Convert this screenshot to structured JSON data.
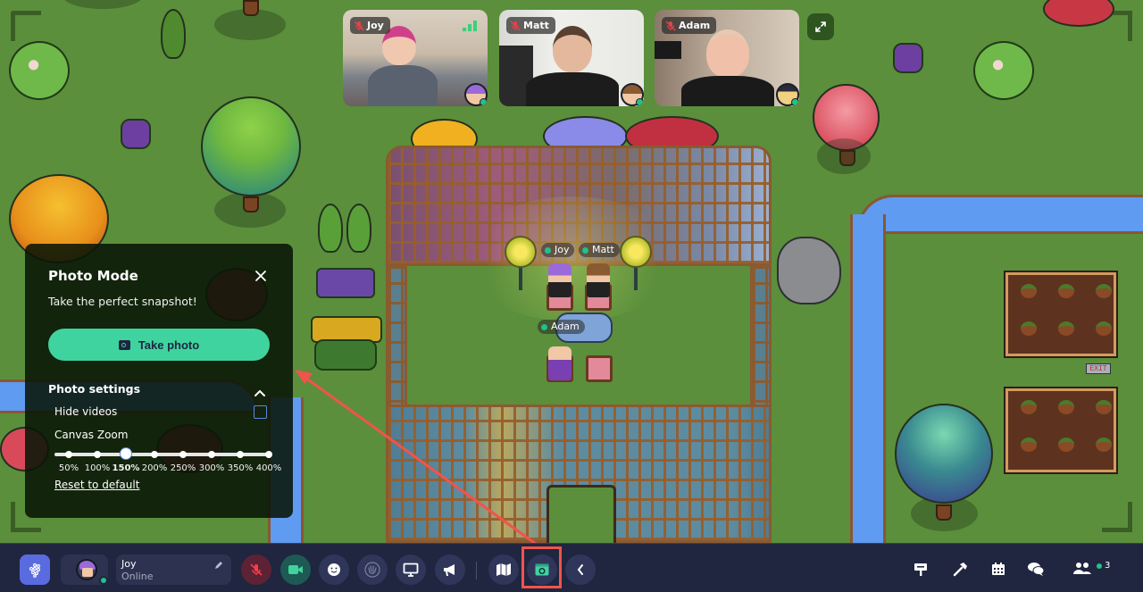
{
  "map": {
    "players": [
      {
        "name": "Joy",
        "status_color": "#1fc28b"
      },
      {
        "name": "Matt",
        "status_color": "#1fc28b"
      },
      {
        "name": "Adam",
        "status_color": "#1fc28b"
      }
    ],
    "signs": {
      "exit": "EXIT"
    }
  },
  "videos": [
    {
      "name": "Joy",
      "muted": true,
      "icon": "mic-off-icon",
      "show_signal": true
    },
    {
      "name": "Matt",
      "muted": true,
      "icon": "mic-off-icon",
      "show_signal": false
    },
    {
      "name": "Adam",
      "muted": true,
      "icon": "mic-off-icon",
      "show_signal": false
    }
  ],
  "video_controls": {
    "expand_icon": "expand-icon"
  },
  "photo_mode": {
    "title": "Photo Mode",
    "subtitle": "Take the perfect snapshot!",
    "take_photo_label": "Take photo",
    "settings_title": "Photo settings",
    "settings_expanded": true,
    "hide_videos_label": "Hide videos",
    "hide_videos_checked": false,
    "canvas_zoom_label": "Canvas Zoom",
    "zoom_options": [
      "50%",
      "100%",
      "150%",
      "200%",
      "250%",
      "300%",
      "350%",
      "400%"
    ],
    "zoom_selected": "150%",
    "zoom_selected_index": 2,
    "reset_label": "Reset to default"
  },
  "toolbar": {
    "user": {
      "name": "Joy",
      "status": "Online",
      "status_color": "#1fc28b"
    },
    "buttons": [
      {
        "name": "microphone",
        "icon": "mic-off-icon",
        "state": "off"
      },
      {
        "name": "camera",
        "icon": "video-camera-icon",
        "state": "on"
      },
      {
        "name": "emote",
        "icon": "smiley-icon"
      },
      {
        "name": "wave",
        "icon": "wave-hand-icon"
      },
      {
        "name": "screen-share",
        "icon": "monitor-icon"
      },
      {
        "name": "announce",
        "icon": "megaphone-icon"
      },
      {
        "name": "map",
        "icon": "map-icon"
      },
      {
        "name": "photo-mode",
        "icon": "camera-window-icon",
        "active": true
      },
      {
        "name": "collapse",
        "icon": "chevron-left-icon"
      }
    ],
    "right_icons": [
      "signpost-icon",
      "hammer-icon",
      "calendar-icon",
      "chat-icon",
      "people-icon"
    ],
    "participant_count": "3"
  },
  "colors": {
    "accent_green": "#3fd3a0",
    "toolbar_bg": "#202540",
    "highlight_red": "#f0544c",
    "online": "#1fc28b"
  }
}
